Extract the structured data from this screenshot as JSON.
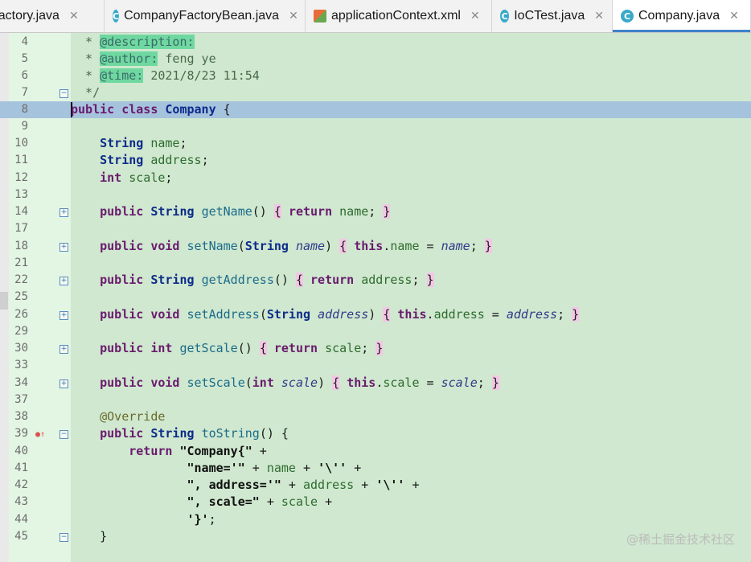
{
  "tabs": [
    {
      "label": "Factory.java",
      "icon": "close-icon"
    },
    {
      "label": "CompanyFactoryBean.java",
      "icon": "java-class-icon"
    },
    {
      "label": "applicationContext.xml",
      "icon": "xml-file-icon"
    },
    {
      "label": "IoCTest.java",
      "icon": "java-class-icon"
    },
    {
      "label": "Company.java",
      "icon": "java-class-icon"
    }
  ],
  "line_numbers": [
    "4",
    "5",
    "6",
    "7",
    "8",
    "9",
    "10",
    "11",
    "12",
    "13",
    "14",
    "17",
    "18",
    "21",
    "22",
    "25",
    "26",
    "29",
    "30",
    "33",
    "34",
    "37",
    "38",
    "39",
    "40",
    "41",
    "42",
    "43",
    "44",
    "45"
  ],
  "code": {
    "doc_description": "@description:",
    "doc_author": "@author:",
    "author_name": "feng ye",
    "doc_time": "@time:",
    "time_value": "2021/8/23 11:54",
    "class_decl": "Company",
    "toString_company": "\"Company{\"",
    "toString_name": "\"name='\"",
    "toString_address": "\", address='\"",
    "toString_scale": "\", scale=\"",
    "toString_close": "'}'"
  },
  "watermark": "@稀土掘金技术社区",
  "colors": {
    "editor_bg": "#cfe8cf",
    "current_line": "#a6c3dd",
    "keyword": "#0d2b8a",
    "doc_tag": "#6fd8a0"
  }
}
